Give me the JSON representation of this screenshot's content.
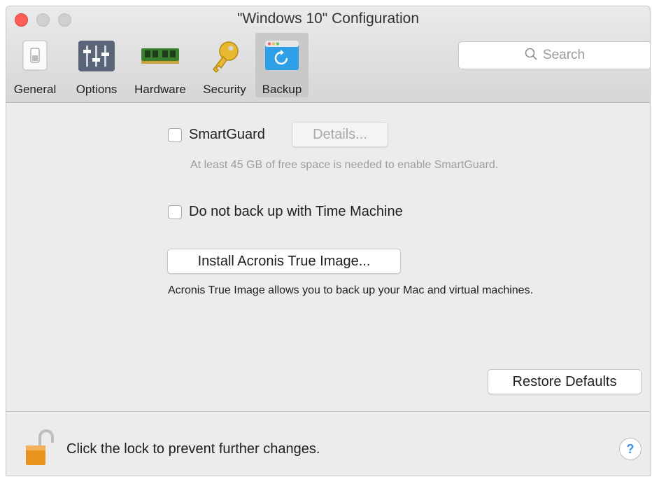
{
  "window": {
    "title": "\"Windows 10\" Configuration"
  },
  "toolbar": {
    "tabs": [
      {
        "label": "General",
        "icon": "general-switch-icon"
      },
      {
        "label": "Options",
        "icon": "options-sliders-icon"
      },
      {
        "label": "Hardware",
        "icon": "hardware-memory-icon"
      },
      {
        "label": "Security",
        "icon": "security-key-icon"
      },
      {
        "label": "Backup",
        "icon": "backup-restore-icon",
        "selected": true
      }
    ],
    "search_placeholder": "Search"
  },
  "backup": {
    "smartguard_label": "SmartGuard",
    "smartguard_checked": false,
    "details_button": "Details...",
    "smartguard_note": "At least 45 GB of free space is needed to enable SmartGuard.",
    "time_machine_label": "Do not back up with Time Machine",
    "time_machine_checked": false,
    "install_button": "Install Acronis True Image...",
    "acronis_note": "Acronis True Image allows you to back up your Mac and virtual machines.",
    "restore_button": "Restore Defaults"
  },
  "footer": {
    "lock_text": "Click the lock to prevent further changes.",
    "help_label": "?"
  },
  "colors": {
    "accent": "#3f8ef5",
    "close": "#fc5f57",
    "lock": "#e8931e"
  }
}
